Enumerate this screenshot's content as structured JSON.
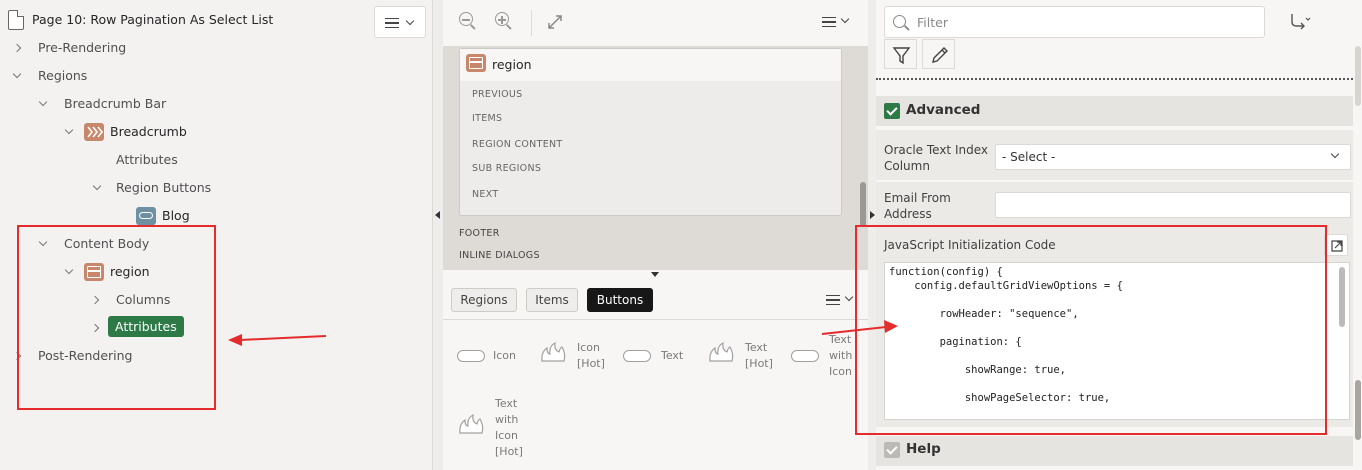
{
  "left_panel": {
    "page_title": "Page 10: Row Pagination As Select List",
    "tree": {
      "pre_rendering": "Pre-Rendering",
      "regions": "Regions",
      "breadcrumb_bar": "Breadcrumb Bar",
      "breadcrumb": "Breadcrumb",
      "attributes_1": "Attributes",
      "region_buttons": "Region Buttons",
      "blog": "Blog",
      "content_body": "Content Body",
      "region": "region",
      "columns": "Columns",
      "attributes_selected": "Attributes",
      "post_rendering": "Post-Rendering"
    }
  },
  "middle_panel": {
    "region_title": "region",
    "slots": [
      "PREVIOUS",
      "ITEMS",
      "REGION CONTENT",
      "SUB REGIONS",
      "NEXT"
    ],
    "footer": "FOOTER",
    "inline_dialogs": "INLINE DIALOGS",
    "tabs": [
      "Regions",
      "Items",
      "Buttons"
    ],
    "active_tab": "Buttons",
    "gallery": {
      "icon": "Icon",
      "icon_hot_1": "Icon",
      "icon_hot_2": "[Hot]",
      "text": "Text",
      "text_hot_1": "Text",
      "text_hot_2": "[Hot]",
      "twi_1": "Text",
      "twi_2": "with",
      "twi_3": "Icon",
      "twih_1": "Text",
      "twih_2": "with",
      "twih_3": "Icon",
      "twih_4": "[Hot]"
    }
  },
  "right_panel": {
    "filter_placeholder": "Filter",
    "advanced_title": "Advanced",
    "oracle_label_1": "Oracle Text Index",
    "oracle_label_2": "Column",
    "oracle_value": "- Select -",
    "email_label_1": "Email From",
    "email_label_2": "Address",
    "js_label": "JavaScript Initialization Code",
    "code": {
      "l1": "function(config) {",
      "l2": "    config.defaultGridViewOptions = {",
      "l3": "        rowHeader: \"sequence\",",
      "l4": "        pagination: {",
      "l5": "            showRange: true,",
      "l6": "            showPageSelector: true,"
    },
    "help_title": "Help"
  },
  "colors": {
    "accent_green": "#2d7a46",
    "annotation_red": "#e52b2b",
    "node_orange": "#c8876a"
  }
}
